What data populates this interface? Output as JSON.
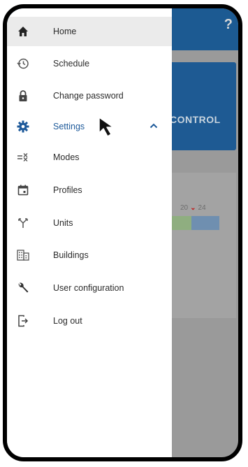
{
  "background": {
    "help_glyph": "?",
    "card_label": "CONTROL",
    "scale": {
      "left": "20",
      "right": "24"
    }
  },
  "menu": {
    "items": [
      {
        "label": "Home",
        "icon": "home-icon"
      },
      {
        "label": "Schedule",
        "icon": "history-icon"
      },
      {
        "label": "Change password",
        "icon": "lock-icon"
      },
      {
        "label": "Settings",
        "icon": "gear-icon"
      },
      {
        "label": "Modes",
        "icon": "modes-icon"
      },
      {
        "label": "Profiles",
        "icon": "calendar-icon"
      },
      {
        "label": "Units",
        "icon": "units-fork-icon"
      },
      {
        "label": "Buildings",
        "icon": "buildings-icon"
      },
      {
        "label": "User configuration",
        "icon": "wrench-icon"
      },
      {
        "label": "Log out",
        "icon": "logout-icon"
      }
    ],
    "selected": "Settings",
    "settings_expand_icon": "chevron-up-icon"
  },
  "colors": {
    "accent": "#1e5a9a",
    "header": "#1c5a92",
    "overlay": "#9a9a9a"
  }
}
